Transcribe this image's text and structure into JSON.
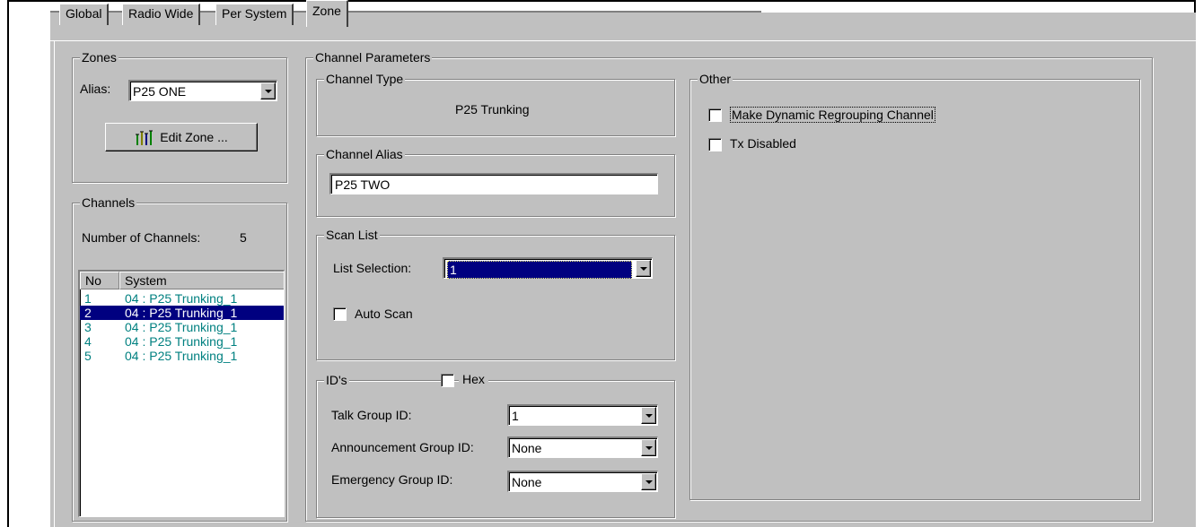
{
  "tabs": [
    "Global",
    "Radio Wide",
    "Per System",
    "Zone"
  ],
  "active_tab": "Zone",
  "zones": {
    "legend": "Zones",
    "alias_label": "Alias:",
    "alias_value": "P25 ONE",
    "edit_button": "Edit Zone ..."
  },
  "channels": {
    "legend": "Channels",
    "count_label": "Number of Channels:",
    "count_value": "5",
    "columns": [
      "No",
      "System"
    ],
    "rows": [
      {
        "no": "1",
        "system": "04 : P25 Trunking_1"
      },
      {
        "no": "2",
        "system": "04 : P25 Trunking_1"
      },
      {
        "no": "3",
        "system": "04 : P25 Trunking_1"
      },
      {
        "no": "4",
        "system": "04 : P25 Trunking_1"
      },
      {
        "no": "5",
        "system": "04 : P25 Trunking_1"
      }
    ],
    "selected_index": 1
  },
  "params": {
    "legend": "Channel Parameters",
    "channel_type": {
      "legend": "Channel Type",
      "value": "P25 Trunking"
    },
    "channel_alias": {
      "legend": "Channel Alias",
      "value": "P25 TWO"
    },
    "scan_list": {
      "legend": "Scan List",
      "list_selection_label": "List Selection:",
      "list_selection_value": "1",
      "auto_scan_label": "Auto Scan"
    },
    "ids": {
      "legend": "ID's",
      "hex_label": "Hex",
      "talk_group_label": "Talk Group ID:",
      "talk_group_value": "1",
      "announcement_label": "Announcement Group ID:",
      "announcement_value": "None",
      "emergency_label": "Emergency Group ID:",
      "emergency_value": "None"
    },
    "other": {
      "legend": "Other",
      "dynamic_regroup_label": "Make Dynamic Regrouping Channel",
      "tx_disabled_label": "Tx Disabled"
    }
  },
  "colors": {
    "face": "#c0c0c0",
    "selection": "#000080",
    "list_text": "#008080"
  },
  "icons": {
    "edit_zone": "antenna-tower-icon",
    "dropdown": "chevron-down-icon"
  }
}
